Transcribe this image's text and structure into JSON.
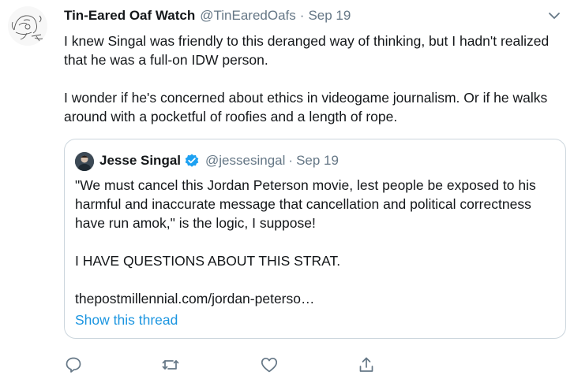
{
  "tweet": {
    "author_name": "Tin-Eared Oaf Watch",
    "author_handle": "@TinEaredOafs",
    "separator": "·",
    "date": "Sep 19",
    "paragraphs": [
      "I knew Singal was friendly to this deranged way of thinking, but I hadn't realized that he was a full-on IDW person.",
      "I wonder if he's concerned about ethics in videogame journalism. Or if he walks around with a pocketful of roofies and a length of rope."
    ]
  },
  "quote": {
    "author_name": "Jesse Singal",
    "author_handle": "@jessesingal",
    "separator": "·",
    "date": "Sep 19",
    "paragraphs": [
      "\"We must cancel this Jordan Peterson movie, lest people be exposed to his harmful and inaccurate message that cancellation and political correctness have run amok,\" is the logic, I suppose!",
      "I HAVE QUESTIONS ABOUT THIS STRAT.",
      "thepostmillennial.com/jordan-peterso…"
    ],
    "show_thread": "Show this thread"
  },
  "actions": [
    "reply-icon",
    "retweet-icon",
    "like-icon",
    "share-icon"
  ],
  "colors": {
    "text": "#14171a",
    "secondary": "#657786",
    "link": "#1b95e0",
    "verified": "#1da1f2",
    "border": "#ccd6dd"
  }
}
